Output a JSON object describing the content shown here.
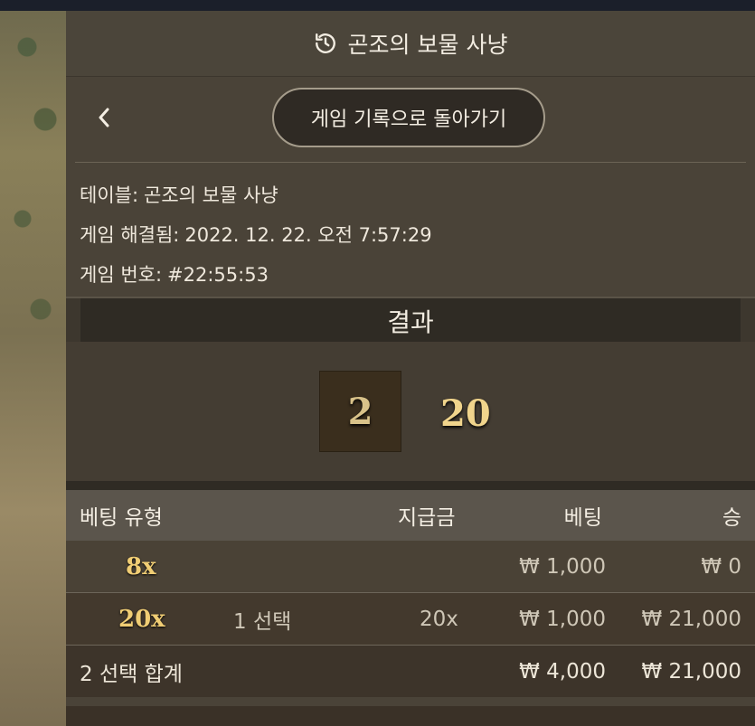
{
  "header": {
    "title": "곤조의 보물 사냥",
    "icon": "history-icon"
  },
  "nav": {
    "back_label": "게임 기록으로 돌아가기"
  },
  "info": [
    {
      "label": "테이블:",
      "value": "곤조의 보물 사냥"
    },
    {
      "label": "게임 해결됨:",
      "value": "2022. 12. 22. 오전 7:57:29"
    },
    {
      "label": "게임 번호:",
      "value": "#22:55:53"
    }
  ],
  "result": {
    "title": "결과",
    "box_value": "2",
    "value": "20"
  },
  "table": {
    "headers": {
      "type": "베팅 유형",
      "payout": "지급금",
      "bet": "베팅",
      "win": "승"
    },
    "rows": [
      {
        "type": "8x",
        "choice": "",
        "payout": "",
        "bet": "₩ 1,000",
        "win": "₩ 0"
      },
      {
        "type": "20x",
        "choice": "1 선택",
        "payout": "20x",
        "bet": "₩ 1,000",
        "win": "₩ 21,000"
      }
    ],
    "total": {
      "label": "2 선택 합계",
      "bet": "₩ 4,000",
      "win": "₩ 21,000"
    }
  },
  "colors": {
    "panel": "#4a4338",
    "gold": "#f0cd74",
    "header_row": "#5b554c"
  }
}
